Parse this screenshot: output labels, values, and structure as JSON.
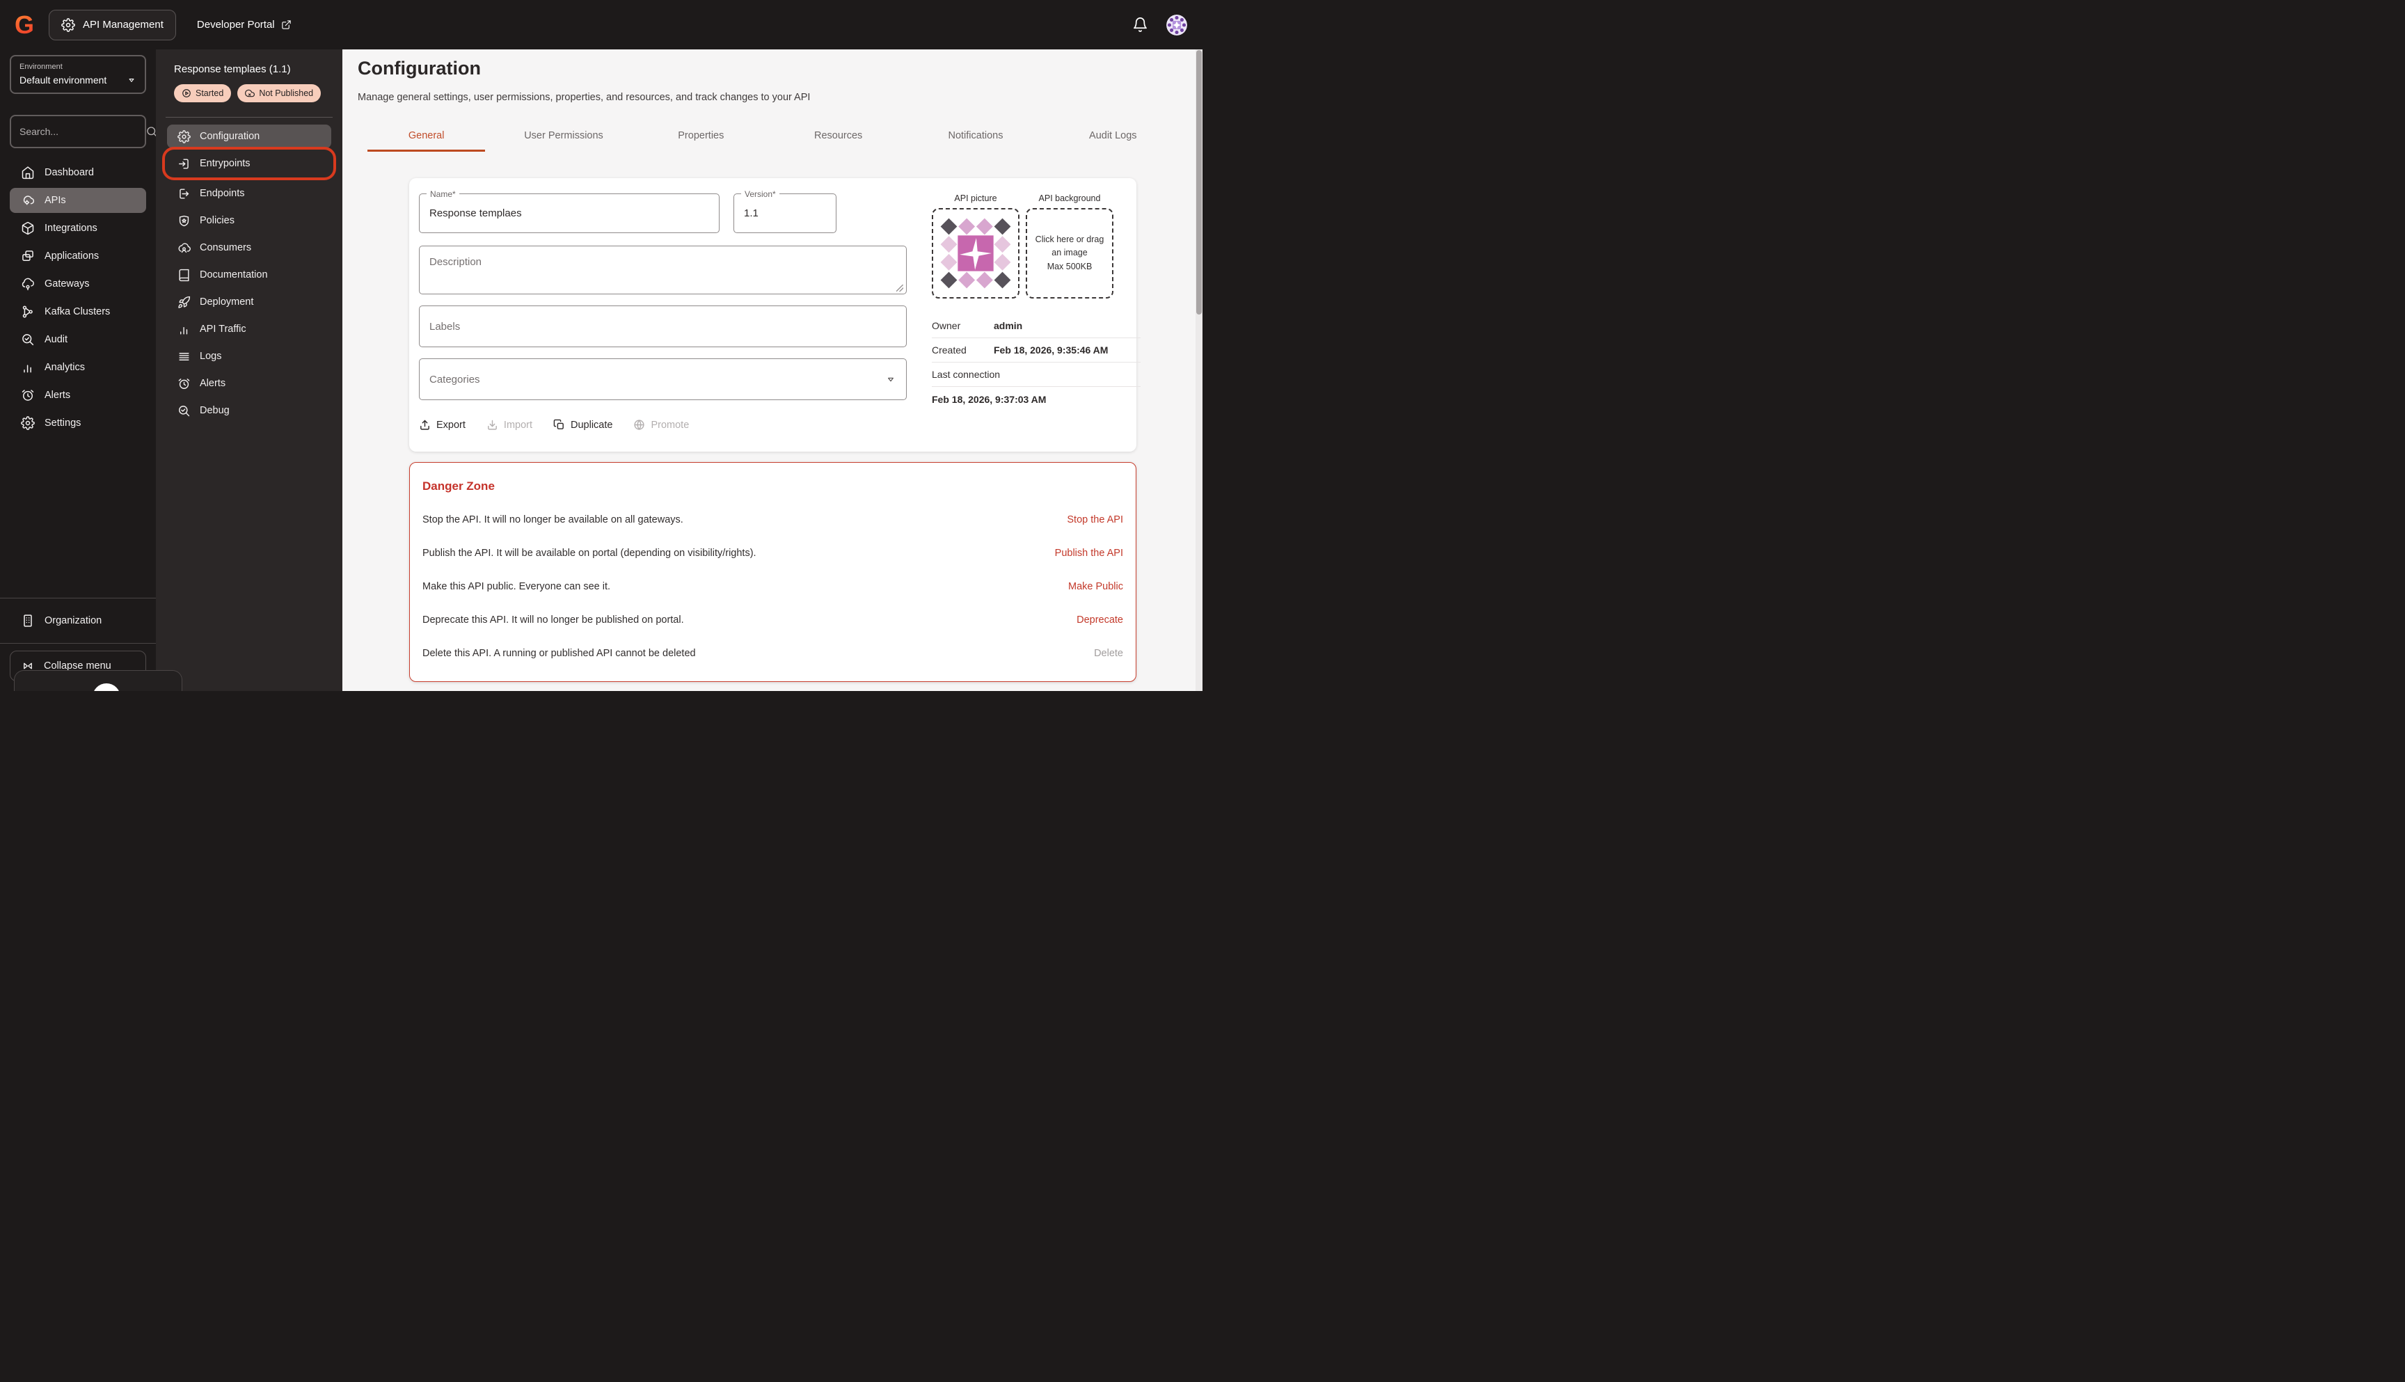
{
  "topbar": {
    "app_switcher": "API Management",
    "portal_link": "Developer Portal"
  },
  "sidebar": {
    "environment_label": "Environment",
    "environment_value": "Default environment",
    "search_placeholder": "Search...",
    "items": [
      {
        "label": "Dashboard"
      },
      {
        "label": "APIs",
        "selected": true
      },
      {
        "label": "Integrations"
      },
      {
        "label": "Applications"
      },
      {
        "label": "Gateways"
      },
      {
        "label": "Kafka Clusters"
      },
      {
        "label": "Audit"
      },
      {
        "label": "Analytics"
      },
      {
        "label": "Alerts"
      },
      {
        "label": "Settings"
      }
    ],
    "organization_label": "Organization",
    "collapse_label": "Collapse menu"
  },
  "api_menu": {
    "title": "Response templaes (1.1)",
    "badges": [
      {
        "label": "Started"
      },
      {
        "label": "Not Published"
      }
    ],
    "items": [
      {
        "label": "Configuration",
        "selected": true
      },
      {
        "label": "Entrypoints",
        "annotated": true
      },
      {
        "label": "Endpoints"
      },
      {
        "label": "Policies"
      },
      {
        "label": "Consumers"
      },
      {
        "label": "Documentation"
      },
      {
        "label": "Deployment"
      },
      {
        "label": "API Traffic"
      },
      {
        "label": "Logs"
      },
      {
        "label": "Alerts"
      },
      {
        "label": "Debug"
      }
    ]
  },
  "page": {
    "title": "Configuration",
    "subtitle": "Manage general settings, user permissions, properties, and resources, and track changes to your API",
    "tabs": [
      {
        "label": "General",
        "active": true
      },
      {
        "label": "User Permissions"
      },
      {
        "label": "Properties"
      },
      {
        "label": "Resources"
      },
      {
        "label": "Notifications"
      },
      {
        "label": "Audit Logs"
      }
    ]
  },
  "form": {
    "name_label": "Name*",
    "name_value": "Response templaes",
    "version_label": "Version*",
    "version_value": "1.1",
    "description_placeholder": "Description",
    "labels_placeholder": "Labels",
    "categories_placeholder": "Categories"
  },
  "actions": [
    {
      "label": "Export",
      "enabled": true
    },
    {
      "label": "Import",
      "enabled": false
    },
    {
      "label": "Duplicate",
      "enabled": true
    },
    {
      "label": "Promote",
      "enabled": false
    }
  ],
  "details": {
    "picture_label": "API picture",
    "background_label": "API background",
    "background_hint": "Click here or drag an image",
    "background_max": "Max 500KB",
    "owner_label": "Owner",
    "owner_value": "admin",
    "created_label": "Created",
    "created_value": "Feb 18, 2026, 9:35:46 AM",
    "last_connection_label": "Last connection",
    "last_connection_value": "Feb 18, 2026, 9:37:03 AM"
  },
  "danger_zone": {
    "title": "Danger Zone",
    "rows": [
      {
        "text": "Stop the API. It will no longer be available on all gateways.",
        "action": "Stop the API",
        "enabled": true
      },
      {
        "text": "Publish the API. It will be available on portal (depending on visibility/rights).",
        "action": "Publish the API",
        "enabled": true
      },
      {
        "text": "Make this API public. Everyone can see it.",
        "action": "Make Public",
        "enabled": true
      },
      {
        "text": "Deprecate this API. It will no longer be published on portal.",
        "action": "Deprecate",
        "enabled": true
      },
      {
        "text": "Delete this API. A running or published API cannot be deleted",
        "action": "Delete",
        "enabled": false
      }
    ]
  },
  "colors": {
    "topbar_bg": "#1d1a1a",
    "subsidebar_bg": "#2b2727",
    "badge_bg": "#f7cdbb",
    "annotation_ring": "#d83a1e",
    "active_tab": "#c14d2b",
    "danger": "#c3392a",
    "logo_orange": "#f1492c"
  }
}
